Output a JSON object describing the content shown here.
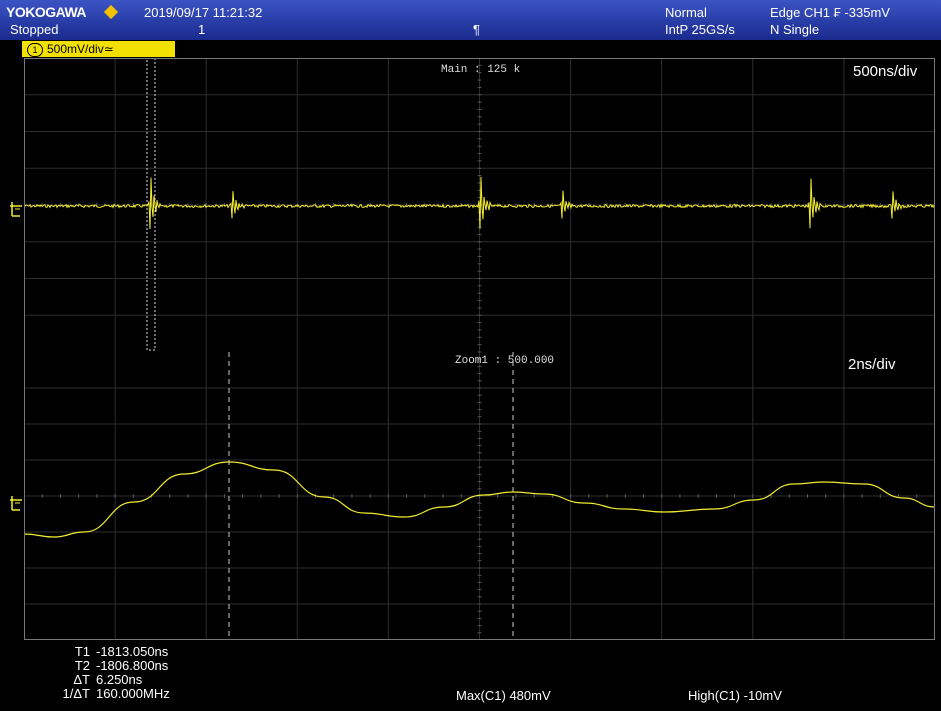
{
  "header": {
    "brand": "YOKOGAWA",
    "datetime": "2019/09/17  11:21:32",
    "state": "Stopped",
    "acq_count": "1",
    "trigger_position_symbol": "¶",
    "mode": "Normal",
    "sample_rate": "IntP 25GS/s",
    "trigger": "Edge CH1 ₣ -335mV",
    "acquisition": "N Single",
    "accent_color": "#f2c200"
  },
  "channel": {
    "number": "1",
    "scale": "500mV/div",
    "coupling_symbol": "≃",
    "color": "#f2e000"
  },
  "main_window": {
    "label": "Main : 125 k",
    "time_scale": "500ns/div"
  },
  "zoom_window": {
    "label": "Zoom1 : 500.000",
    "time_scale": "2ns/div"
  },
  "cursors": {
    "rows": [
      {
        "label": "T1",
        "value": "-1813.050ns"
      },
      {
        "label": "T2",
        "value": "-1806.800ns"
      },
      {
        "label": "ΔT",
        "value": "6.250ns"
      },
      {
        "label": "1/ΔT",
        "value": "160.000MHz"
      }
    ]
  },
  "measurements": {
    "max": "Max(C1)   480mV",
    "high": "High(C1)  -10mV"
  },
  "icons": [
    "ground-marker-icon",
    "trigger-diamond-icon"
  ]
}
